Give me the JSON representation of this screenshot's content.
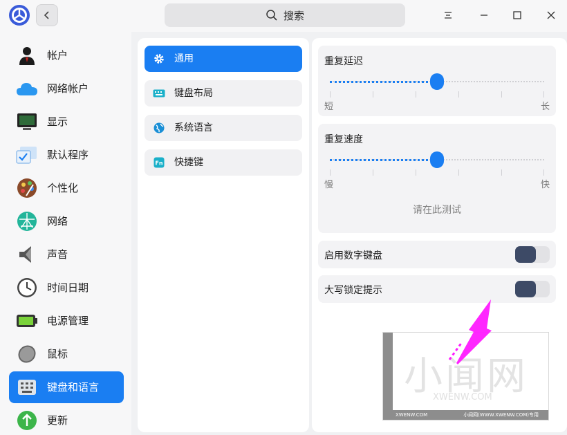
{
  "window": {
    "search_placeholder": "搜索"
  },
  "nav": {
    "items": [
      {
        "label": "帐户",
        "icon": "account-icon"
      },
      {
        "label": "网络帐户",
        "icon": "cloud-icon"
      },
      {
        "label": "显示",
        "icon": "display-icon"
      },
      {
        "label": "默认程序",
        "icon": "default-apps-icon"
      },
      {
        "label": "个性化",
        "icon": "palette-icon"
      },
      {
        "label": "网络",
        "icon": "network-icon"
      },
      {
        "label": "声音",
        "icon": "speaker-icon"
      },
      {
        "label": "时间日期",
        "icon": "clock-icon"
      },
      {
        "label": "电源管理",
        "icon": "battery-icon"
      },
      {
        "label": "鼠标",
        "icon": "mouse-icon"
      },
      {
        "label": "键盘和语言",
        "icon": "keyboard-icon",
        "active": true
      },
      {
        "label": "更新",
        "icon": "update-icon"
      }
    ]
  },
  "submenu": {
    "items": [
      {
        "label": "通用",
        "icon": "gear-icon",
        "active": true
      },
      {
        "label": "键盘布局",
        "icon": "keyboard-layout-icon"
      },
      {
        "label": "系统语言",
        "icon": "globe-icon"
      },
      {
        "label": "快捷键",
        "icon": "fn-icon"
      }
    ]
  },
  "settings": {
    "repeat_delay": {
      "title": "重复延迟",
      "min_label": "短",
      "max_label": "长",
      "value_fraction": 0.5
    },
    "repeat_rate": {
      "title": "重复速度",
      "min_label": "慢",
      "max_label": "快",
      "value_fraction": 0.5,
      "test_placeholder": "请在此测试"
    },
    "numlock": {
      "label": "启用数字键盘",
      "enabled": false
    },
    "capslock_hint": {
      "label": "大写锁定提示",
      "enabled": false
    }
  },
  "watermark": {
    "big_text": "小闻网",
    "url": "XWENW.COM",
    "side_text": "小闻网(WWW.XWENW.COM)",
    "foot_left": "XWENW.COM",
    "foot_right": "小闻网(WWW.XWENW.COM)专用"
  },
  "colors": {
    "accent": "#1a7ef2",
    "toggle_knob": "#3d4a66",
    "annotation_arrow": "#ff1aff"
  }
}
